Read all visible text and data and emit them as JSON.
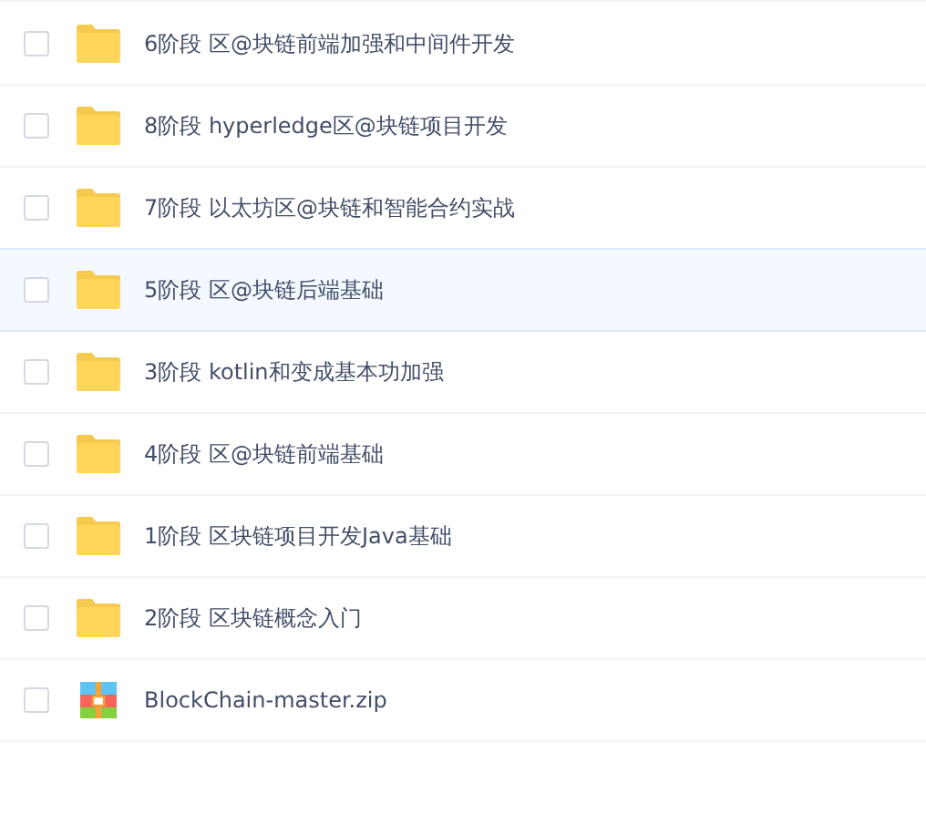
{
  "files": [
    {
      "name": "6阶段 区@块链前端加强和中间件开发",
      "kind": "folder",
      "checked": false,
      "highlighted": false
    },
    {
      "name": "8阶段 hyperledge区@块链项目开发",
      "kind": "folder",
      "checked": false,
      "highlighted": false
    },
    {
      "name": "7阶段 以太坊区@块链和智能合约实战",
      "kind": "folder",
      "checked": false,
      "highlighted": false
    },
    {
      "name": "5阶段 区@块链后端基础",
      "kind": "folder",
      "checked": false,
      "highlighted": true
    },
    {
      "name": "3阶段 kotlin和变成基本功加强",
      "kind": "folder",
      "checked": false,
      "highlighted": false
    },
    {
      "name": "4阶段 区@块链前端基础",
      "kind": "folder",
      "checked": false,
      "highlighted": false
    },
    {
      "name": "1阶段 区块链项目开发Java基础",
      "kind": "folder",
      "checked": false,
      "highlighted": false
    },
    {
      "name": "2阶段 区块链概念入门",
      "kind": "folder",
      "checked": false,
      "highlighted": false
    },
    {
      "name": "BlockChain-master.zip",
      "kind": "zip",
      "checked": false,
      "highlighted": false
    }
  ]
}
